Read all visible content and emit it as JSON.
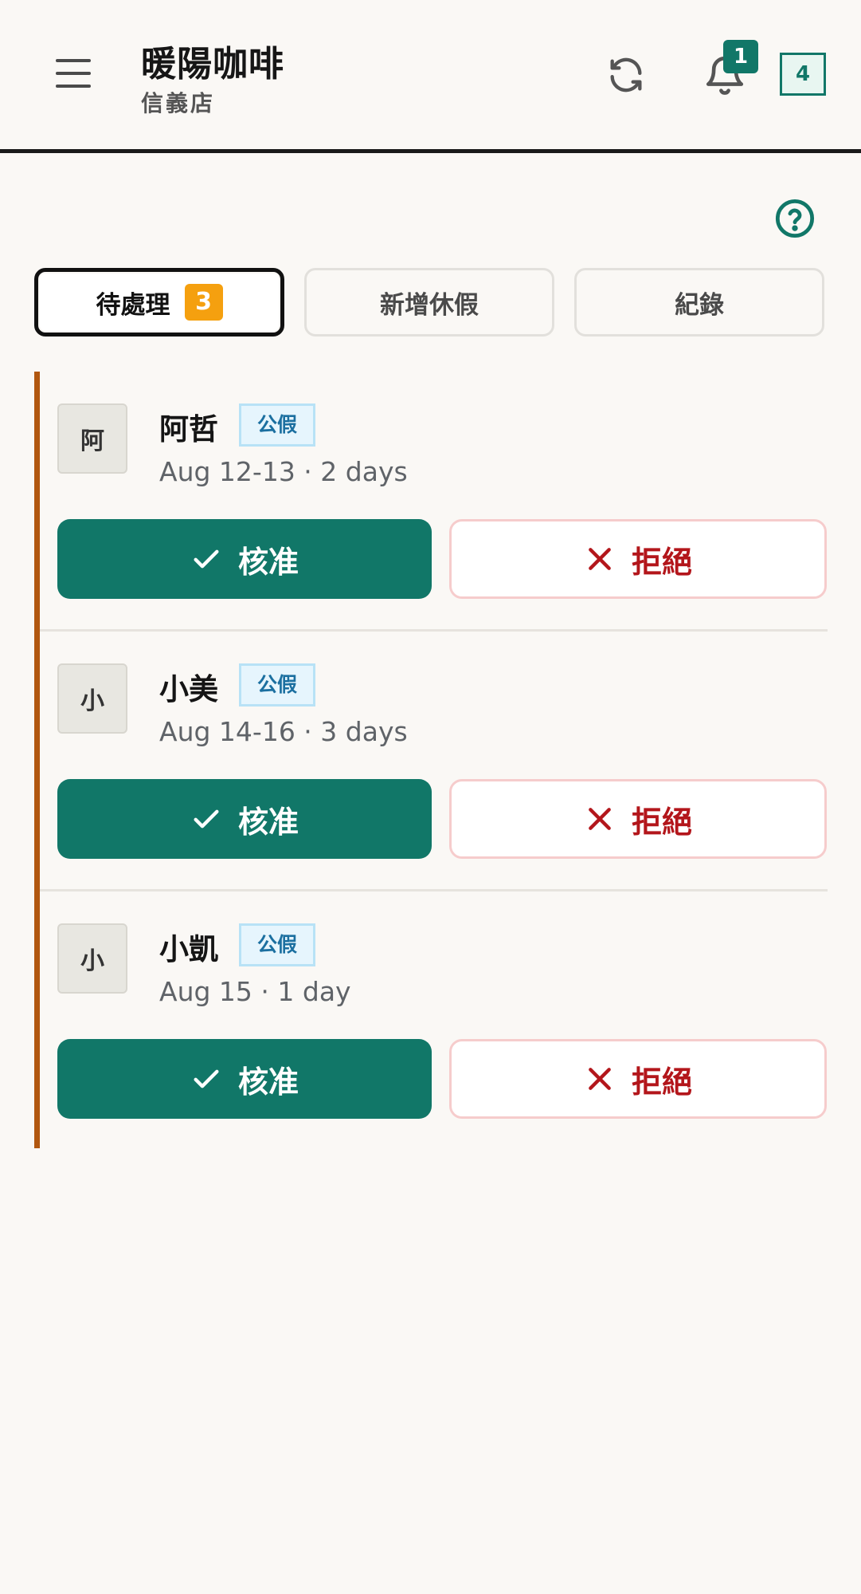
{
  "header": {
    "title": "暖陽咖啡",
    "subtitle": "信義店",
    "notification_count": "1",
    "count_box": "4"
  },
  "tabs": [
    {
      "label": "待處理",
      "badge": "3",
      "active": true
    },
    {
      "label": "新增休假",
      "active": false
    },
    {
      "label": "紀錄",
      "active": false
    }
  ],
  "requests": [
    {
      "avatar": "阿",
      "name": "阿哲",
      "tag": "公假",
      "dates": "Aug 12-13 · 2 days"
    },
    {
      "avatar": "小",
      "name": "小美",
      "tag": "公假",
      "dates": "Aug 14-16 · 3 days"
    },
    {
      "avatar": "小",
      "name": "小凱",
      "tag": "公假",
      "dates": "Aug 15 · 1 day"
    }
  ],
  "actions": {
    "approve_label": "核准",
    "reject_label": "拒絕"
  },
  "icons": {
    "menu": "menu-icon",
    "refresh": "refresh-icon",
    "bell": "bell-icon",
    "help": "help-icon",
    "check": "check-icon",
    "close": "close-icon"
  },
  "colors": {
    "primary": "#117768",
    "accent_bar": "#b1570f",
    "badge": "#f5a00f",
    "reject": "#b3161b",
    "tag_text": "#1b6fa0"
  }
}
